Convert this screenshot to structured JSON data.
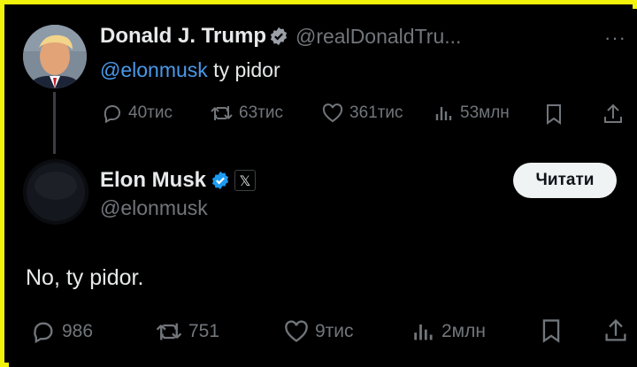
{
  "reply_tweet": {
    "author_name": "Donald J. Trump",
    "author_handle": "@realDonaldTru...",
    "mention": "@elonmusk",
    "text": " ty pidor",
    "more_label": "···",
    "replies": "40тис",
    "reposts": "63тис",
    "likes": "361тис",
    "views": "53млн"
  },
  "main_tweet": {
    "author_name": "Elon Musk",
    "author_handle": "@elonmusk",
    "affiliate_badge": "𝕏",
    "follow_button": "Читати",
    "text": "No, ty pidor.",
    "replies": "986",
    "reposts": "751",
    "likes": "9тис",
    "views": "2млн"
  },
  "colors": {
    "background": "#000000",
    "frame": "#f2f20a",
    "mention": "#4a99e9",
    "verified": "#1d9bf0",
    "muted": "#71767b",
    "text": "#e7e9ea"
  },
  "icons": [
    "reply-icon",
    "repost-icon",
    "like-icon",
    "views-icon",
    "bookmark-icon",
    "share-icon",
    "verified-badge-icon"
  ]
}
